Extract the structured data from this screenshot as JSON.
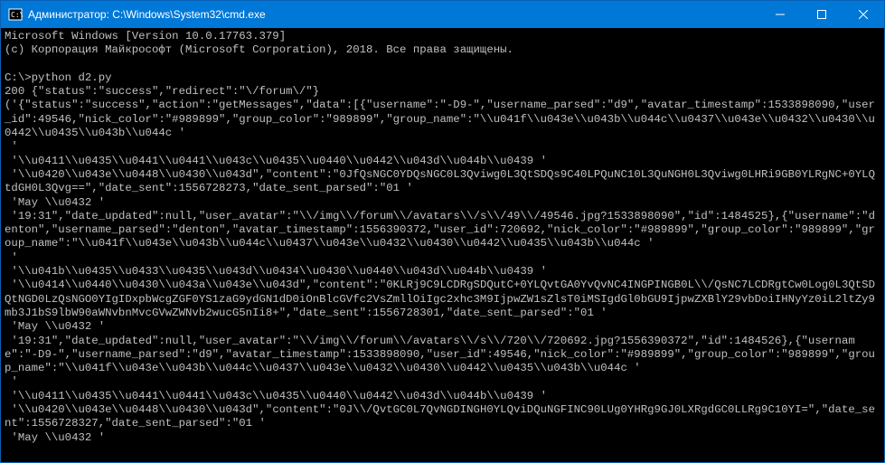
{
  "titlebar": {
    "title": "Администратор: C:\\Windows\\System32\\cmd.exe"
  },
  "terminal": {
    "line1": "Microsoft Windows [Version 10.0.17763.379]",
    "line2": "(c) Корпорация Майкрософт (Microsoft Corporation), 2018. Все права защищены.",
    "blank1": "",
    "prompt": "C:\\>python d2.py",
    "out1": "200 {\"status\":\"success\",\"redirect\":\"\\/forum\\/\"}",
    "out2": "('{\"status\":\"success\",\"action\":\"getMessages\",\"data\":[{\"username\":\"-D9-\",\"username_parsed\":\"d9\",\"avatar_timestamp\":1533898090,\"user_id\":49546,\"nick_color\":\"#989899\",\"group_color\":\"989899\",\"group_name\":\"\\\\u041f\\\\u043e\\\\u043b\\\\u044c\\\\u0437\\\\u043e\\\\u0432\\\\u0430\\\\u0442\\\\u0435\\\\u043b\\\\u044c '",
    "out3": " '",
    "out4": " '\\\\u0411\\\\u0435\\\\u0441\\\\u0441\\\\u043c\\\\u0435\\\\u0440\\\\u0442\\\\u043d\\\\u044b\\\\u0439 '",
    "out5": " '\\\\u0420\\\\u043e\\\\u0448\\\\u0430\\\\u043d\",\"content\":\"0JfQsNGC0YDQsNGC0L3Qviwg0L3QtSDQs9C40LPQuNC10L3QuNGH0L3Qviwg0LHRi9GB0YLRgNC+0YLQtdGH0L3Qvg==\",\"date_sent\":1556728273,\"date_sent_parsed\":\"01 '",
    "out6": " 'May \\\\u0432 '",
    "out7": " '19:31\",\"date_updated\":null,\"user_avatar\":\"\\\\/img\\\\/forum\\\\/avatars\\\\/s\\\\/49\\\\/49546.jpg?1533898090\",\"id\":1484525},{\"username\":\"denton\",\"username_parsed\":\"denton\",\"avatar_timestamp\":1556390372,\"user_id\":720692,\"nick_color\":\"#989899\",\"group_color\":\"989899\",\"group_name\":\"\\\\u041f\\\\u043e\\\\u043b\\\\u044c\\\\u0437\\\\u043e\\\\u0432\\\\u0430\\\\u0442\\\\u0435\\\\u043b\\\\u044c '",
    "out8": " '",
    "out9": " '\\\\u041b\\\\u0435\\\\u0433\\\\u0435\\\\u043d\\\\u0434\\\\u0430\\\\u0440\\\\u043d\\\\u044b\\\\u0439 '",
    "out10": " '\\\\u0414\\\\u0440\\\\u0430\\\\u043a\\\\u043e\\\\u043d\",\"content\":\"0KLRj9C9LCDRgSDQutC+0YLQvtGA0YvQvNC4INGPINGB0L\\\\/QsNC7LCDRgtCw0Log0L3QtSDQtNGD0LzQsNGO0YIgIDxpbWcgZGF0YS1zaG9ydGN1dD0iOnBlcGVfc2VsZmllOiIgc2xhc3M9IjpwZW1sZlsT0iMSIgdGl0bGU9IjpwZXBlY29vbDoiIHNyYz0iL2ltZy9mb3J1bS9lbW90aWNvbnMvcGVwZWNvb2wucG5nIi8+\",\"date_sent\":1556728301,\"date_sent_parsed\":\"01 '",
    "out11": " 'May \\\\u0432 '",
    "out12": " '19:31\",\"date_updated\":null,\"user_avatar\":\"\\\\/img\\\\/forum\\\\/avatars\\\\/s\\\\/720\\\\/720692.jpg?1556390372\",\"id\":1484526},{\"username\":\"-D9-\",\"username_parsed\":\"d9\",\"avatar_timestamp\":1533898090,\"user_id\":49546,\"nick_color\":\"#989899\",\"group_color\":\"989899\",\"group_name\":\"\\\\u041f\\\\u043e\\\\u043b\\\\u044c\\\\u0437\\\\u043e\\\\u0432\\\\u0430\\\\u0442\\\\u0435\\\\u043b\\\\u044c '",
    "out13": " '",
    "out14": " '\\\\u0411\\\\u0435\\\\u0441\\\\u0441\\\\u043c\\\\u0435\\\\u0440\\\\u0442\\\\u043d\\\\u044b\\\\u0439 '",
    "out15": " '\\\\u0420\\\\u043e\\\\u0448\\\\u0430\\\\u043d\",\"content\":\"0J\\\\/QvtGC0L7QvNGDINGH0YLQviDQuNGFINC90LUg0YHRg9GJ0LXRgdGC0LLRg9C10YI=\",\"date_sent\":1556728327,\"date_sent_parsed\":\"01 '",
    "out16": " 'May \\\\u0432 '"
  }
}
